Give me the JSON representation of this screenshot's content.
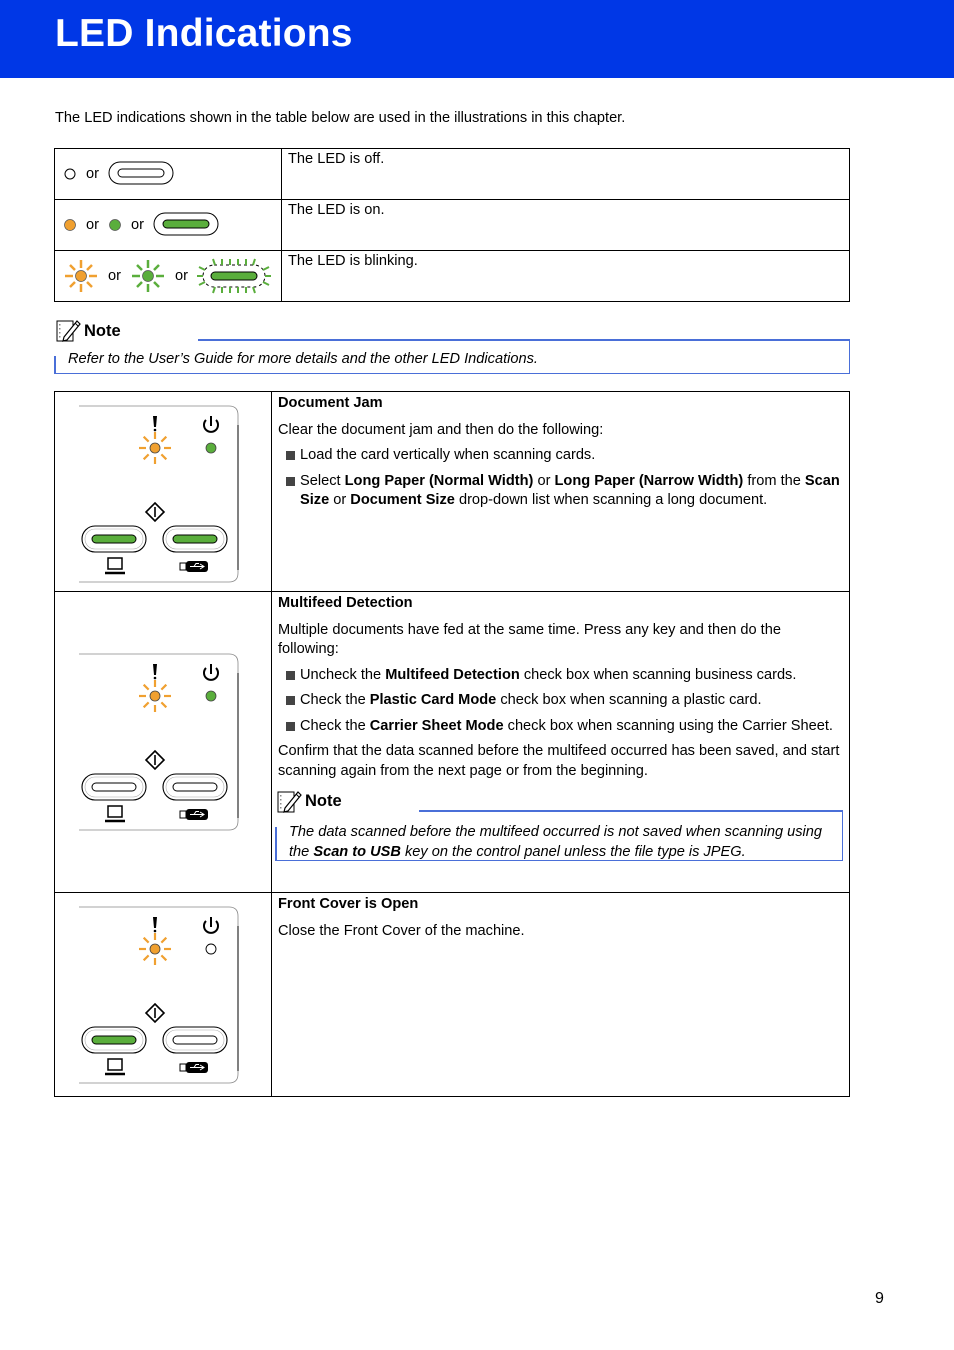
{
  "header": {
    "title": "LED Indications",
    "band_color": "#0037e6"
  },
  "intro_text": "The LED indications shown in the table below are used in the illustrations in this chapter.",
  "legend": {
    "or_label": "or",
    "rows": [
      {
        "symbols": [
          "led-off-circle",
          "key-off"
        ],
        "description": "The LED is off."
      },
      {
        "symbols": [
          "led-on-orange",
          "led-on-green",
          "key-on-green"
        ],
        "description": "The LED is on."
      },
      {
        "symbols": [
          "led-blink-orange",
          "led-blink-green",
          "key-blink-green"
        ],
        "description": "The LED is blinking."
      }
    ]
  },
  "note": {
    "label": "Note",
    "text": "Refer to the User’s Guide for more details and the other LED Indications."
  },
  "colors": {
    "orange": "#f0a030",
    "green": "#5aae3c",
    "note_border": "#4a6fd8"
  },
  "errors": [
    {
      "title": "Document Jam",
      "intro": "Clear the document jam and then do the following:",
      "bullets": [
        {
          "parts": [
            {
              "t": "Load the card vertically when scanning cards."
            }
          ]
        },
        {
          "parts": [
            {
              "t": "Select "
            },
            {
              "t": "Long Paper (Normal Width)",
              "b": true
            },
            {
              "t": " or "
            },
            {
              "t": "Long Paper (Narrow Width)",
              "b": true
            },
            {
              "t": " from the "
            },
            {
              "t": "Scan Size",
              "b": true
            },
            {
              "t": " or "
            },
            {
              "t": "Document Size",
              "b": true
            },
            {
              "t": " drop-down list when scanning a long document."
            }
          ]
        }
      ],
      "panel": {
        "error_led": "blinking-orange",
        "power_led": "on-green",
        "pc_key": "on-green",
        "usb_key": "on-green"
      }
    },
    {
      "title": "Multifeed Detection",
      "intro": "Multiple documents have fed at the same time. Press any key and then do the following:",
      "bullets": [
        {
          "parts": [
            {
              "t": "Uncheck the "
            },
            {
              "t": "Multifeed Detection",
              "b": true
            },
            {
              "t": " check box when scanning business cards."
            }
          ]
        },
        {
          "parts": [
            {
              "t": "Check the "
            },
            {
              "t": "Plastic Card Mode",
              "b": true
            },
            {
              "t": " check box when scanning a plastic card."
            }
          ]
        },
        {
          "parts": [
            {
              "t": "Check the "
            },
            {
              "t": "Carrier Sheet Mode",
              "b": true
            },
            {
              "t": " check box when scanning using the Carrier Sheet."
            }
          ]
        }
      ],
      "outro": "Confirm that the data scanned before the multifeed occurred has been saved, and start scanning again from the next page or from the beginning.",
      "note": {
        "label": "Note",
        "parts": [
          {
            "t": "The data scanned before the multifeed occurred is not saved when scanning using the "
          },
          {
            "t": "Scan to USB",
            "b": true
          },
          {
            "t": " key on the control panel unless the file type is JPEG."
          }
        ]
      },
      "panel": {
        "error_led": "blinking-orange",
        "power_led": "on-green",
        "pc_key": "off",
        "usb_key": "off"
      }
    },
    {
      "title": "Front Cover is Open",
      "intro": "Close the Front Cover of the machine.",
      "bullets": [],
      "panel": {
        "error_led": "blinking-orange",
        "power_led": "off",
        "pc_key": "on-green",
        "usb_key": "off"
      }
    }
  ],
  "page_number": "9"
}
